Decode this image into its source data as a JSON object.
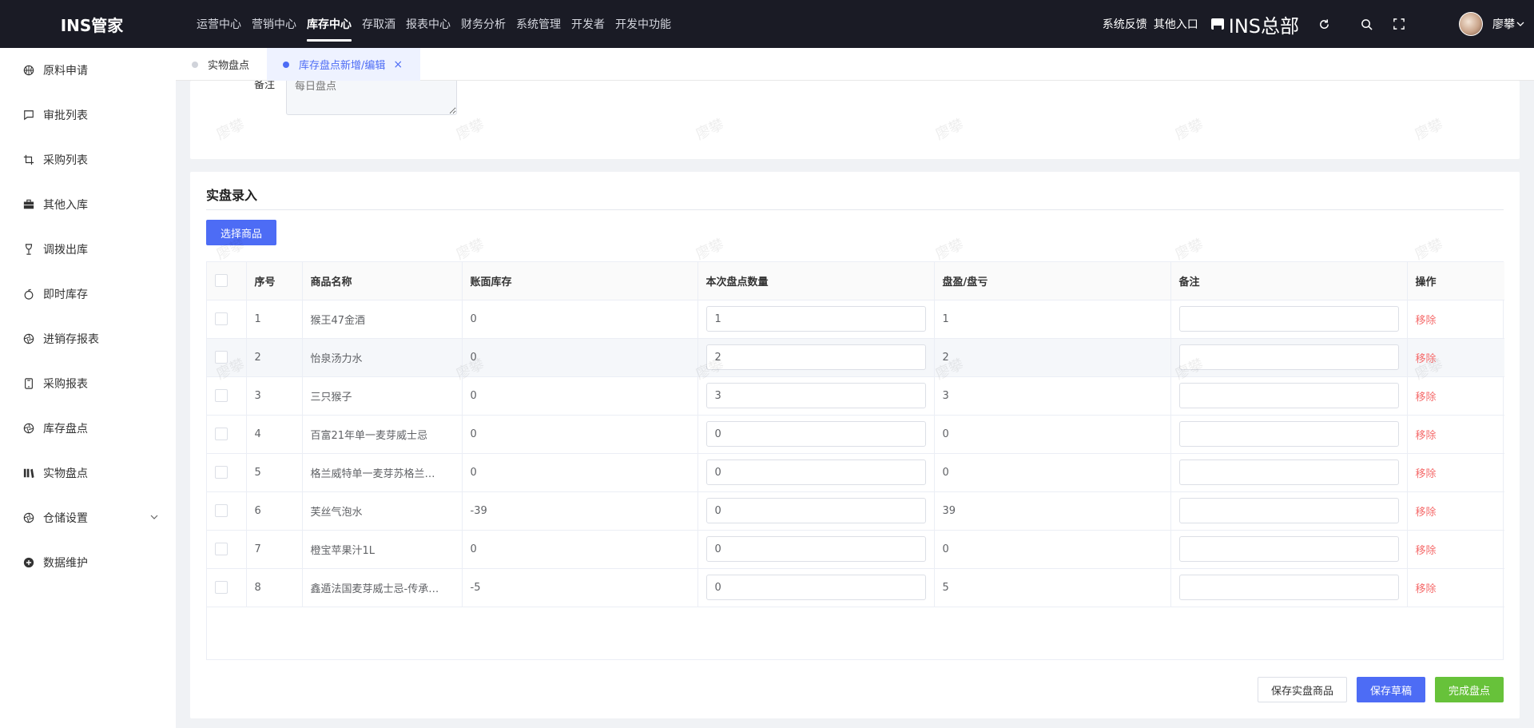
{
  "app": {
    "logo": "INS管家"
  },
  "topnav": {
    "items": [
      {
        "label": "运营中心"
      },
      {
        "label": "营销中心"
      },
      {
        "label": "库存中心",
        "active": true
      },
      {
        "label": "存取酒"
      },
      {
        "label": "报表中心"
      },
      {
        "label": "财务分析"
      },
      {
        "label": "系统管理"
      },
      {
        "label": "开发者"
      },
      {
        "label": "开发中功能"
      }
    ],
    "feedback": "系统反馈",
    "other_entry": "其他入口",
    "store_name": "INS总部",
    "username": "廖攀"
  },
  "sidebar": {
    "items": [
      {
        "label": "原料申请",
        "icon": "basketball-icon"
      },
      {
        "label": "审批列表",
        "icon": "chat-icon"
      },
      {
        "label": "采购列表",
        "icon": "crop-icon"
      },
      {
        "label": "其他入库",
        "icon": "suitcase-icon"
      },
      {
        "label": "调拨出库",
        "icon": "goblet-icon"
      },
      {
        "label": "即时库存",
        "icon": "apple-icon"
      },
      {
        "label": "进销存报表",
        "icon": "aperture-icon"
      },
      {
        "label": "采购报表",
        "icon": "phone-icon"
      },
      {
        "label": "库存盘点",
        "icon": "aperture-icon"
      },
      {
        "label": "实物盘点",
        "icon": "bar-icon"
      },
      {
        "label": "仓储设置",
        "icon": "aperture-icon"
      },
      {
        "label": "数据维护",
        "icon": "plus-circle-icon"
      }
    ]
  },
  "tabs": {
    "items": [
      {
        "label": "实物盘点"
      },
      {
        "label": "库存盘点新增/编辑",
        "active": true
      }
    ]
  },
  "form": {
    "remark_label": "备注",
    "remark_placeholder": "每日盘点"
  },
  "section": {
    "title": "实盘录入",
    "select_button": "选择商品"
  },
  "table": {
    "headers": {
      "index": "序号",
      "name": "商品名称",
      "book_stock": "账面库存",
      "count_qty": "本次盘点数量",
      "diff": "盘盈/盘亏",
      "remark": "备注",
      "action": "操作"
    },
    "remove_label": "移除",
    "rows": [
      {
        "index": "1",
        "name": "猴王47金酒",
        "book_stock": "0",
        "count_qty": "1",
        "diff": "1"
      },
      {
        "index": "2",
        "name": "怡泉汤力水",
        "book_stock": "0",
        "count_qty": "2",
        "diff": "2"
      },
      {
        "index": "3",
        "name": "三只猴子",
        "book_stock": "0",
        "count_qty": "3",
        "diff": "3"
      },
      {
        "index": "4",
        "name": "百富21年单一麦芽威士忌",
        "book_stock": "0",
        "count_qty": "0",
        "diff": "0"
      },
      {
        "index": "5",
        "name": "格兰威特单一麦芽苏格兰…",
        "book_stock": "0",
        "count_qty": "0",
        "diff": "0"
      },
      {
        "index": "6",
        "name": "芙丝气泡水",
        "book_stock": "-39",
        "count_qty": "0",
        "diff": "39"
      },
      {
        "index": "7",
        "name": "橙宝苹果汁1L",
        "book_stock": "0",
        "count_qty": "0",
        "diff": "0"
      },
      {
        "index": "8",
        "name": "鑫遁法国麦芽威士忌-传承…",
        "book_stock": "-5",
        "count_qty": "0",
        "diff": "5"
      }
    ]
  },
  "footer": {
    "save_goods": "保存实盘商品",
    "save_draft": "保存草稿",
    "finish": "完成盘点"
  },
  "watermark": "廖攀"
}
